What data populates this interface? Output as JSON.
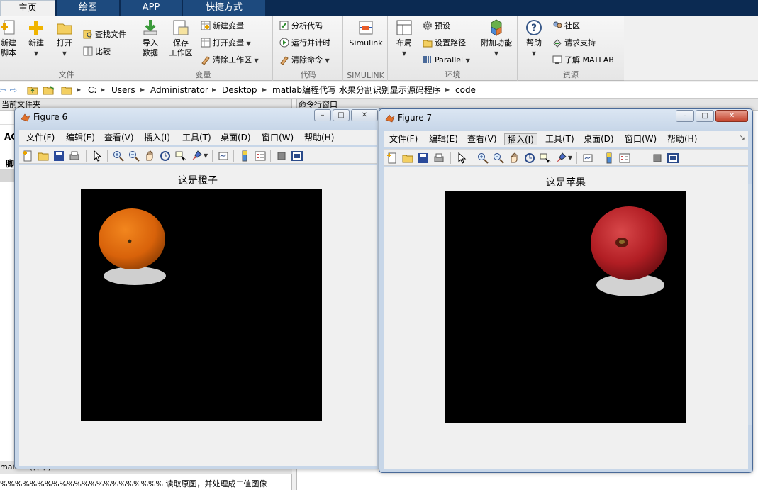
{
  "tabs": [
    {
      "label": "主页",
      "active": true
    },
    {
      "label": "绘图"
    },
    {
      "label": "APP"
    },
    {
      "label": "快捷方式"
    }
  ],
  "ribbon": {
    "file_group": {
      "label": "文件",
      "new_script": [
        "新建",
        "脚本"
      ],
      "new": "新建",
      "open": "打开",
      "find_files": "查找文件",
      "compare": "比较"
    },
    "variable_group": {
      "label": "变量",
      "import_data": [
        "导入",
        "数据"
      ],
      "save_workspace": [
        "保存",
        "工作区"
      ],
      "new_variable": "新建变量",
      "open_variable": "打开变量",
      "clear_workspace": "清除工作区"
    },
    "code_group": {
      "label": "代码",
      "analyze_code": "分析代码",
      "run_and_time": "运行并计时",
      "clear_commands": "清除命令"
    },
    "simulink_group": {
      "label": "SIMULINK",
      "simulink": "Simulink"
    },
    "environment_group": {
      "label": "环境",
      "layout": "布局",
      "preferences": "预设",
      "set_path": "设置路径",
      "parallel": "Parallel",
      "add_ons": "附加功能"
    },
    "resources_group": {
      "label": "资源",
      "help": "帮助",
      "community": "社区",
      "request_support": "请求支持",
      "learn_matlab": "了解 MATLAB"
    }
  },
  "address": [
    "C:",
    "Users",
    "Administrator",
    "Desktop",
    "matlab编程代写 水果分割识别显示源码程序",
    "code"
  ],
  "panes": {
    "current_folder": "当前文件夹",
    "command_window": "命令行窗口",
    "left_fragment_1": "AC",
    "left_fragment_2": "脚",
    "left_bottom": "main...  (脚本)",
    "bottom_text": "%%%%%%%%%%%%%%%%%%%%%% 读取原图，并处理成二值图像"
  },
  "menus": [
    "文件(F)",
    "编辑(E)",
    "查看(V)",
    "插入(I)",
    "工具(T)",
    "桌面(D)",
    "窗口(W)",
    "帮助(H)"
  ],
  "figures": [
    {
      "title": "Figure 6",
      "axes_title": "这是橙子",
      "fruit": "orange"
    },
    {
      "title": "Figure 7",
      "axes_title": "这是苹果",
      "fruit": "apple"
    }
  ],
  "window_buttons": {
    "minimize": "–",
    "maximize": "□",
    "close": "✕"
  }
}
